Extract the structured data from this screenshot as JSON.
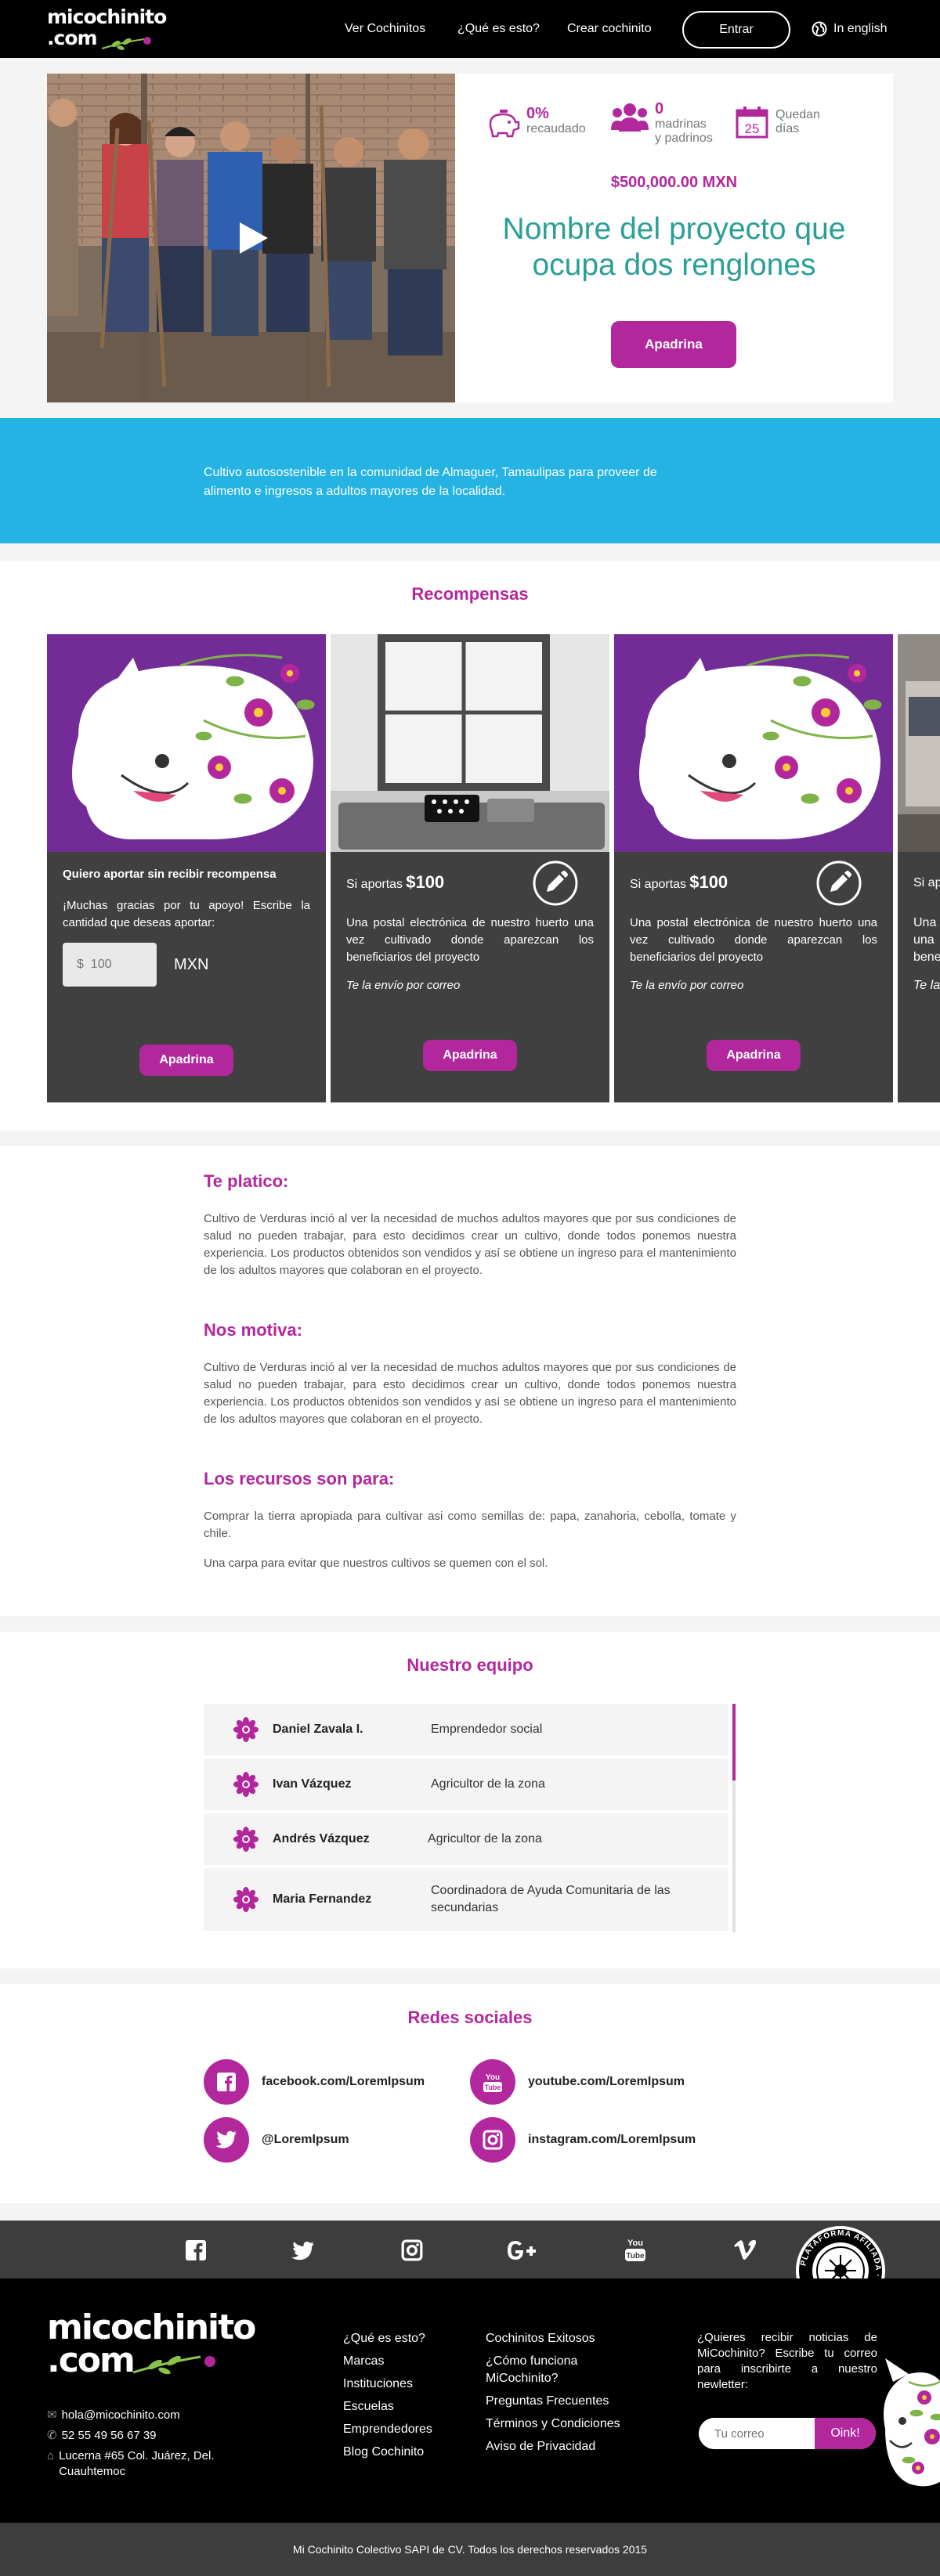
{
  "header": {
    "logo_line1": "micochinito",
    "logo_line2": ".com",
    "nav": [
      "Ver Cochinitos",
      "¿Qué es esto?",
      "Crear cochinito"
    ],
    "login_label": "Entrar",
    "language_label": "In english"
  },
  "hero": {
    "stat_raised_value": "0%",
    "stat_raised_label": "recaudado",
    "stat_sponsors_value": "0",
    "stat_sponsors_label_1": "madrinas",
    "stat_sponsors_label_2": "y padrinos",
    "stat_days_value": "25",
    "stat_days_label_1": "Quedan",
    "stat_days_label_2": "días",
    "goal": "$500,000.00 MXN",
    "project_name_line1": "Nombre del proyecto que",
    "project_name_line2": "ocupa dos renglones",
    "sponsor_button": "Apadrina"
  },
  "summary": {
    "line1": "Cultivo autosostenible en la comunidad de Almaguer, Tamaulipas para proveer de",
    "line2": "alimento e ingresos a adultos mayores de la localidad."
  },
  "rewards": {
    "title": "Recompensas",
    "card1": {
      "title": "Quiero aportar sin recibir recompensa",
      "text": "¡Muchas gracias por tu apoyo! Escribe la cantidad que deseas aportar:",
      "input_placeholder": "$  100",
      "currency": "MXN",
      "button": "Apadrina"
    },
    "card2": {
      "label": "Si aportas",
      "amount": "$100",
      "text": "Una postal electrónica de nuestro huerto una vez cultivado donde aparezcan los beneficiarios del proyecto",
      "delivery": "Te la envío por correo",
      "button": "Apadrina"
    },
    "card3": {
      "label": "Si aportas",
      "amount": "$100",
      "text": "Una postal electrónica de nuestro huerto una vez cultivado donde aparezcan los beneficiarios del proyecto",
      "delivery": "Te la envío por correo",
      "button": "Apadrina"
    },
    "card4": {
      "label": "Si ap",
      "text1": "Una",
      "text2": "una",
      "text3": "bene",
      "delivery": "Te la"
    }
  },
  "story": {
    "h1": "Te platico:",
    "p1": "Cultivo de Verduras inció al ver la necesidad de muchos adultos mayores que por sus condiciones de salud no pueden trabajar, para esto decidimos crear un cultivo, donde todos ponemos nuestra experiencia. Los productos obtenidos son vendidos y así se obtiene un ingreso para el mantenimiento de los adultos mayores que colaboran en el proyecto.",
    "h2": "Nos motiva:",
    "p2": "Cultivo de Verduras inció al ver la necesidad de muchos adultos mayores que por sus condiciones de salud no pueden trabajar, para esto decidimos crear un cultivo, donde todos ponemos nuestra experiencia. Los productos obtenidos son vendidos y así se obtiene un ingreso para el mantenimiento de los adultos mayores que colaboran en el proyecto.",
    "h3": "Los recursos son para:",
    "p3": "Comprar la tierra apropiada para cultivar asi como semillas de: papa, zanahoria, cebolla, tomate y chile.",
    "p4": "Una carpa para evitar que nuestros cultivos se quemen con el sol."
  },
  "team": {
    "title": "Nuestro equipo",
    "members": [
      {
        "name": "Daniel Zavala I.",
        "role": "Emprendedor social"
      },
      {
        "name": "Ivan Vázquez",
        "role": "Agricultor de la zona"
      },
      {
        "name": "Andrés Vázquez",
        "role": "Agricultor de la zona"
      },
      {
        "name": "Maria Fernandez",
        "role": "Coordinadora de Ayuda Comunitaria de las secundarias"
      }
    ]
  },
  "social": {
    "title": "Redes sociales",
    "facebook": "facebook.com/LoremIpsum",
    "youtube": "youtube.com/LoremIpsum",
    "twitter": "@LoremIpsum",
    "instagram": "instagram.com/LoremIpsum"
  },
  "footer": {
    "logo_line1": "micochinito",
    "logo_line2": ".com",
    "email": "hola@micochinito.com",
    "phone": "52 55 49 56 67 39",
    "address": "Lucerna #65 Col. Juárez, Del. Cuauhtemoc",
    "links_col1": [
      "¿Qué es esto?",
      "Marcas",
      "Instituciones",
      "Escuelas",
      "Emprendedores",
      "Blog Cochinito"
    ],
    "links_col2": [
      "Cochinitos Exitosos",
      "¿Cómo funciona MiCochinito?",
      "Preguntas Frecuentes",
      "Términos y Condiciones",
      "Aviso de Privacidad"
    ],
    "newsletter_text": "¿Quieres recibir noticias de MiCochinito? Escribe tu correo para inscribirte a nuestro newletter:",
    "newsletter_placeholder": "Tu correo",
    "newsletter_button": "Oink!",
    "badge_text": "PLATAFORMA AFILIADA · AFICO · APFC",
    "copyright": "Mi Cochinito Colectivo SAPI de CV. Todos los derechos reservados 2015"
  },
  "colors": {
    "brand": "#b3279d",
    "accent_teal": "#2a9f96",
    "blue_band": "#24b3e3"
  }
}
